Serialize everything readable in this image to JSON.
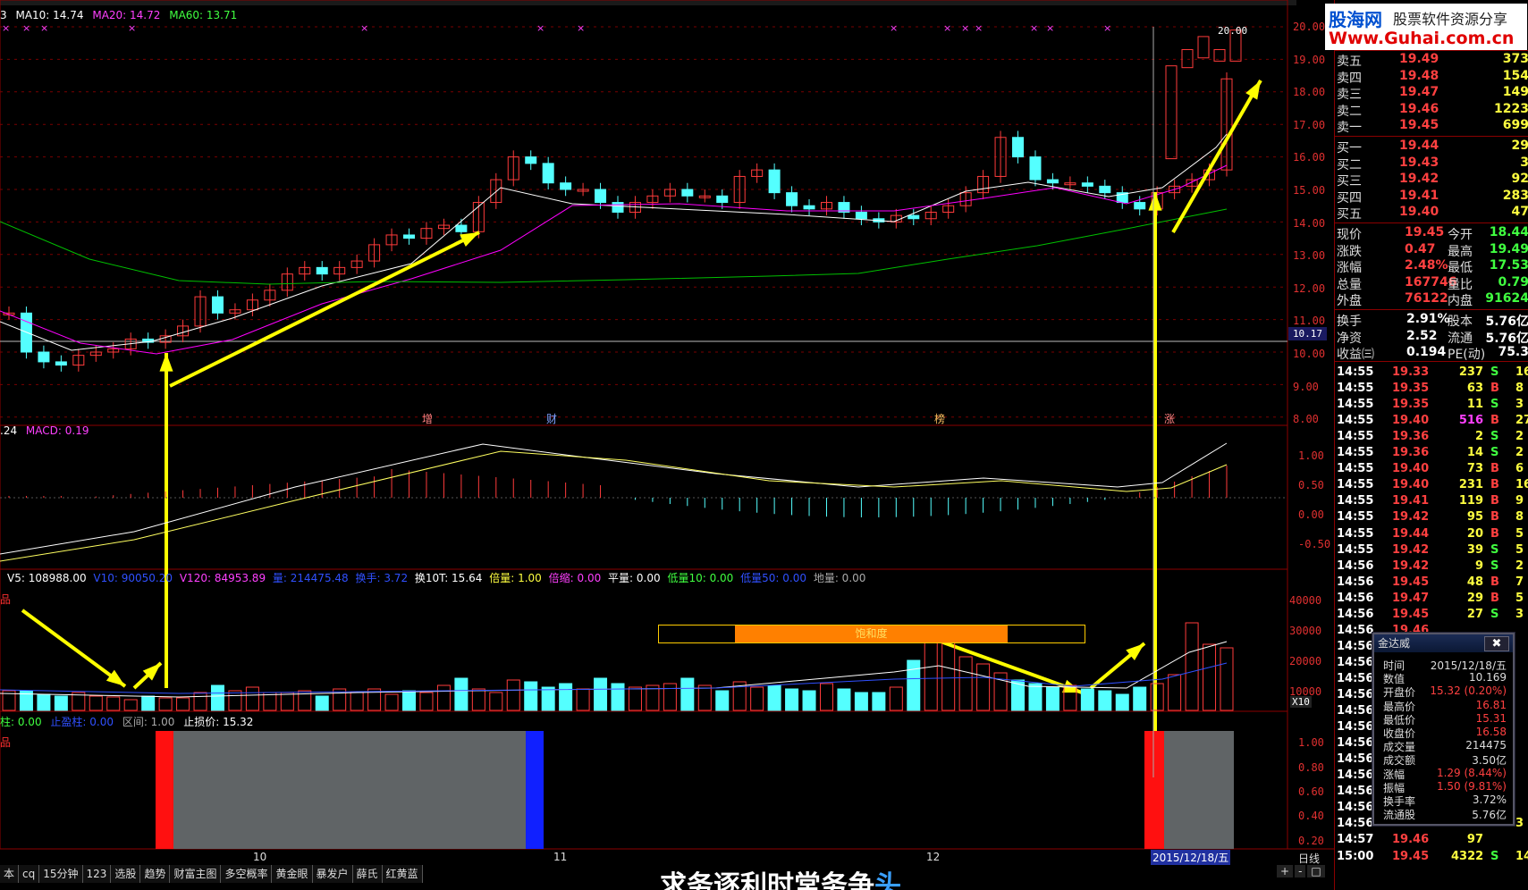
{
  "ma_header": {
    "prefix": "3",
    "ma10": "MA10: 14.74",
    "ma20": "MA20: 14.72",
    "ma60": "MA60: 13.71"
  },
  "macd_header": {
    "prefix": ".24",
    "macd": "MACD: 0.19"
  },
  "vol_header": {
    "v5": "V5: 108988.00",
    "v10": "V10: 90050.20",
    "v120": "V120: 84953.89",
    "liang": "量: 214475.48",
    "huanshou": "换手: 3.72",
    "huan10t": "换10T: 15.64",
    "beiliang": "倍量: 1.00",
    "beisuo": "倍缩: 0.00",
    "pingliang": "平量: 0.00",
    "diliang10": "低量10: 0.00",
    "diliang50": "低量50: 0.00",
    "diliang": "地量: 0.00"
  },
  "stop_header": {
    "zhu": "柱: 0.00",
    "zhiying": "止盈柱: 0.00",
    "qujian": "区间: 1.00",
    "zhisun": "止损价: 15.32"
  },
  "side_labels": {
    "vol_left": "品",
    "stop_left": "品"
  },
  "price_axis": [
    "20.00",
    "19.00",
    "18.00",
    "17.00",
    "16.00",
    "15.00",
    "14.00",
    "13.00",
    "12.00",
    "11.00",
    "10.00",
    "9.00",
    "8.00"
  ],
  "price_high_label": "20.00",
  "current_line_label": "10.17",
  "macd_axis": [
    "1.00",
    "0.50",
    "0.00",
    "-0.50"
  ],
  "vol_axis": [
    "40000",
    "30000",
    "20000",
    "10000"
  ],
  "vol_unit": "X10",
  "stop_axis": [
    "1.00",
    "0.80",
    "0.60",
    "0.40",
    "0.20"
  ],
  "markers": {
    "zeng": "增",
    "cai": "财",
    "bang": "榜",
    "zhang": "涨"
  },
  "saturation_label": "饱和度",
  "months": {
    "m10": "10",
    "m11": "11",
    "m12": "12"
  },
  "date_label": "2015/12/18/五",
  "period_label": "日线",
  "tabs": [
    "本",
    "cq",
    "15分钟",
    "123",
    "选股",
    "趋势",
    "财富主图",
    "多空概率",
    "黄金眼",
    "暴发户",
    "薛氏",
    "红黄蓝"
  ],
  "scroll_buttons": [
    "+",
    "-",
    "□"
  ],
  "bottom_caption": "求务逐利时常务争",
  "bottom_caption_blue": "头",
  "logo": {
    "line1": "股海网",
    "line2": "股票软件资源分享",
    "line3": "Www.Guhai.com.cn"
  },
  "asks": [
    {
      "label": "卖五",
      "price": "19.49",
      "vol": "373"
    },
    {
      "label": "卖四",
      "price": "19.48",
      "vol": "154"
    },
    {
      "label": "卖三",
      "price": "19.47",
      "vol": "149"
    },
    {
      "label": "卖二",
      "price": "19.46",
      "vol": "1223"
    },
    {
      "label": "卖一",
      "price": "19.45",
      "vol": "699"
    }
  ],
  "bids": [
    {
      "label": "买一",
      "price": "19.44",
      "vol": "29"
    },
    {
      "label": "买二",
      "price": "19.43",
      "vol": "3"
    },
    {
      "label": "买三",
      "price": "19.42",
      "vol": "92"
    },
    {
      "label": "买四",
      "price": "19.41",
      "vol": "283"
    },
    {
      "label": "买五",
      "price": "19.40",
      "vol": "47"
    }
  ],
  "stats": [
    {
      "l1": "现价",
      "v1": "19.45",
      "l2": "今开",
      "v2": "18.44"
    },
    {
      "l1": "涨跌",
      "v1": "0.47",
      "l2": "最高",
      "v2": "19.49"
    },
    {
      "l1": "涨幅",
      "v1": "2.48%",
      "l2": "最低",
      "v2": "17.53"
    },
    {
      "l1": "总量",
      "v1": "167746",
      "l2": "量比",
      "v2": "0.79"
    },
    {
      "l1": "外盘",
      "v1": "76122",
      "l2": "内盘",
      "v2": "91624"
    }
  ],
  "stats2": [
    {
      "l1": "换手",
      "v1": "2.91%",
      "l2": "股本",
      "v2": "5.76亿"
    },
    {
      "l1": "净资",
      "v1": "2.52",
      "l2": "流通",
      "v2": "5.76亿"
    },
    {
      "l1": "收益㈢",
      "v1": "0.194",
      "l2": "PE(动)",
      "v2": "75.3"
    }
  ],
  "ticks": [
    {
      "t": "14:55",
      "p": "19.33",
      "v": "237",
      "s": "S",
      "n": "16"
    },
    {
      "t": "14:55",
      "p": "19.35",
      "v": "63",
      "s": "B",
      "n": "8"
    },
    {
      "t": "14:55",
      "p": "19.35",
      "v": "11",
      "s": "S",
      "n": "3"
    },
    {
      "t": "14:55",
      "p": "19.40",
      "v": "516",
      "s": "B",
      "n": "27"
    },
    {
      "t": "14:55",
      "p": "19.36",
      "v": "2",
      "s": "S",
      "n": "2"
    },
    {
      "t": "14:55",
      "p": "19.36",
      "v": "14",
      "s": "S",
      "n": "2"
    },
    {
      "t": "14:55",
      "p": "19.40",
      "v": "73",
      "s": "B",
      "n": "6"
    },
    {
      "t": "14:55",
      "p": "19.40",
      "v": "231",
      "s": "B",
      "n": "16"
    },
    {
      "t": "14:55",
      "p": "19.41",
      "v": "119",
      "s": "B",
      "n": "9"
    },
    {
      "t": "14:55",
      "p": "19.42",
      "v": "95",
      "s": "B",
      "n": "8"
    },
    {
      "t": "14:55",
      "p": "19.44",
      "v": "20",
      "s": "B",
      "n": "5"
    },
    {
      "t": "14:55",
      "p": "19.42",
      "v": "39",
      "s": "S",
      "n": "5"
    },
    {
      "t": "14:56",
      "p": "19.42",
      "v": "9",
      "s": "S",
      "n": "2"
    },
    {
      "t": "14:56",
      "p": "19.45",
      "v": "48",
      "s": "B",
      "n": "7"
    },
    {
      "t": "14:56",
      "p": "19.47",
      "v": "29",
      "s": "B",
      "n": "5"
    },
    {
      "t": "14:56",
      "p": "19.45",
      "v": "27",
      "s": "S",
      "n": "3"
    },
    {
      "t": "14:56",
      "p": "19.46",
      "v": "",
      "s": "",
      "n": ""
    },
    {
      "t": "14:56",
      "p": "",
      "v": "",
      "s": "",
      "n": ""
    },
    {
      "t": "14:56",
      "p": "",
      "v": "",
      "s": "",
      "n": ""
    },
    {
      "t": "14:56",
      "p": "",
      "v": "",
      "s": "",
      "n": ""
    },
    {
      "t": "14:56",
      "p": "",
      "v": "",
      "s": "",
      "n": ""
    },
    {
      "t": "14:56",
      "p": "",
      "v": "",
      "s": "",
      "n": ""
    },
    {
      "t": "14:56",
      "p": "",
      "v": "",
      "s": "",
      "n": ""
    },
    {
      "t": "14:56",
      "p": "",
      "v": "",
      "s": "",
      "n": ""
    },
    {
      "t": "14:56",
      "p": "",
      "v": "",
      "s": "",
      "n": ""
    },
    {
      "t": "14:56",
      "p": "",
      "v": "",
      "s": "",
      "n": ""
    },
    {
      "t": "14:56",
      "p": "",
      "v": "",
      "s": "",
      "n": ""
    },
    {
      "t": "14:56",
      "p": "",
      "v": "",
      "s": "",
      "n": ""
    },
    {
      "t": "14:56",
      "p": "19.46",
      "v": "16",
      "s": "B",
      "n": "3"
    },
    {
      "t": "14:57",
      "p": "19.46",
      "v": "97",
      "s": "",
      "n": ""
    },
    {
      "t": "15:00",
      "p": "19.45",
      "v": "4322",
      "s": "S",
      "n": "149"
    }
  ],
  "popup": {
    "title": "金达威",
    "close": "✖",
    "rows": [
      {
        "k": "时间",
        "v": "2015/12/18/五"
      },
      {
        "k": "数值",
        "v": "10.169"
      },
      {
        "k": "开盘价",
        "v": "15.32 (0.20%)"
      },
      {
        "k": "最高价",
        "v": "16.81"
      },
      {
        "k": "最低价",
        "v": "15.31"
      },
      {
        "k": "收盘价",
        "v": "16.58"
      },
      {
        "k": "成交量",
        "v": "214475"
      },
      {
        "k": "成交额",
        "v": "3.50亿"
      },
      {
        "k": "涨幅",
        "v": "1.29 (8.44%)"
      },
      {
        "k": "振幅",
        "v": "1.50 (9.81%)"
      },
      {
        "k": "换手率",
        "v": "3.72%"
      },
      {
        "k": "流通股",
        "v": "5.76亿"
      }
    ]
  },
  "colors": {
    "up": "#ff3b3b",
    "down": "#54ffff",
    "ma10": "#ffffff",
    "ma20": "#ff00ff",
    "ma60": "#00c000",
    "arrow": "#ffff00",
    "grid": "#8b0000"
  }
}
